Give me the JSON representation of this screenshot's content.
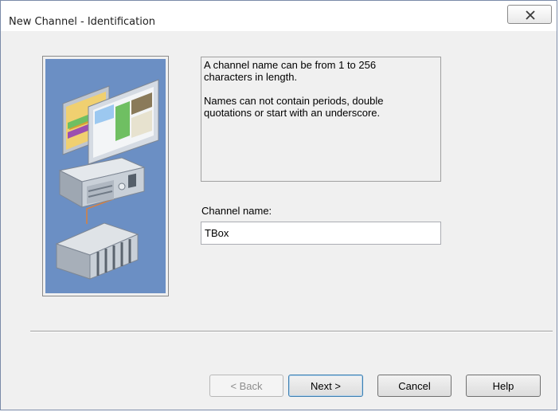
{
  "window": {
    "title": "New Channel - Identification"
  },
  "info": {
    "lines": [
      "A channel name can be from 1 to 256\ncharacters in length.",
      "Names can not contain periods, double\nquotations or start with an underscore."
    ]
  },
  "channel_name": {
    "label": "Channel name:",
    "value": "TBox"
  },
  "buttons": {
    "back": "< Back",
    "next": "Next >",
    "cancel": "Cancel",
    "help": "Help"
  },
  "icons": {
    "close": "close-icon",
    "illustration": "computer-and-plc-illustration"
  },
  "colors": {
    "illustration_background": "#6b8fc4",
    "default_button_border": "#3c7fb1"
  }
}
